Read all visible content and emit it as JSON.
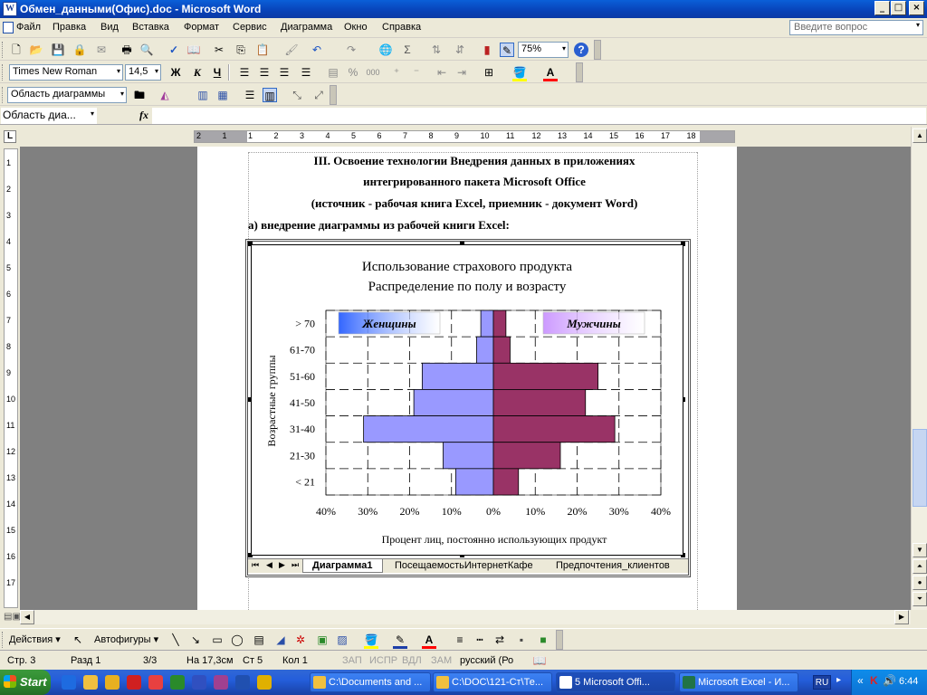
{
  "window": {
    "title": "Обмен_данными(Офис).doc - Microsoft Word",
    "min_glyph": "_",
    "max_glyph": "□",
    "close_glyph": "×"
  },
  "menu": {
    "items": [
      "Файл",
      "Правка",
      "Вид",
      "Вставка",
      "Формат",
      "Сервис",
      "Диаграмма",
      "Окно",
      "Справка"
    ],
    "ask_placeholder": "Введите вопрос",
    "arrow": "▾"
  },
  "toolbar_standard": {
    "zoom": "75%"
  },
  "toolbar_format": {
    "font": "Times New Roman",
    "size": "14,5",
    "bold": "Ж",
    "italic": "К",
    "underline": "Ч"
  },
  "toolbar_chart": {
    "object_select": "Область диаграммы"
  },
  "formula_bar": {
    "name_box": "Область диа...",
    "fx": "fx"
  },
  "ruler": {
    "h_labels": [
      "2",
      "1",
      "1",
      "2",
      "3",
      "4",
      "5",
      "6",
      "7",
      "8",
      "9",
      "10",
      "11",
      "12",
      "13",
      "14",
      "15",
      "16",
      "17",
      "18"
    ],
    "v_labels": [
      "1",
      "2",
      "3",
      "4",
      "5",
      "6",
      "7",
      "8",
      "9",
      "10",
      "11",
      "12",
      "13",
      "14",
      "15",
      "16",
      "17"
    ],
    "tab_selector": "L"
  },
  "document": {
    "heading_lines": [
      "III. Освоение технологии Внедрения данных в приложениях",
      "интегрированного пакета Microsoft Office",
      "(источник - рабочая книга Excel, приемник - документ Word)"
    ],
    "subheading": "а) внедрение диаграммы из рабочей книги Excel:"
  },
  "sheet_tabs": [
    "Диаграмма1",
    "ПосещаемостьИнтернетКафе",
    "Предпочтения_клиентов"
  ],
  "sheet_nav": [
    "⏮",
    "◀",
    "▶",
    "⏭"
  ],
  "chart_data": {
    "type": "bar",
    "orientation": "horizontal",
    "title": "Использование страхового продукта",
    "subtitle": "Распределение по полу и возрасту",
    "categories": [
      "> 70",
      "61-70",
      "51-60",
      "41-50",
      "31-40",
      "21-30",
      "< 21"
    ],
    "series": [
      {
        "name": "Женщины",
        "values": [
          3,
          4,
          17,
          19,
          31,
          12,
          9
        ],
        "color": "#9999FF",
        "direction": "left"
      },
      {
        "name": "Мужчины",
        "values": [
          3,
          4,
          25,
          22,
          29,
          16,
          6
        ],
        "color": "#993366",
        "direction": "right"
      }
    ],
    "xlim": [
      -40,
      40
    ],
    "x_ticks": [
      "40%",
      "30%",
      "20%",
      "10%",
      "0%",
      "10%",
      "20%",
      "30%",
      "40%"
    ],
    "xlabel": "Процент лиц, постоянно использующих продукт",
    "ylabel": "Возрастные группы",
    "grid": "dashed",
    "legend_box_colors": [
      "#3366FF",
      "#CC99FF"
    ]
  },
  "draw_toolbar": {
    "actions": "Действия",
    "autoshapes": "Автофигуры"
  },
  "status_bar": {
    "page": "Стр.  3",
    "section": "Разд  1",
    "pages": "3/3",
    "at": "На  17,3см",
    "line": "Ст  5",
    "col": "Кол  1",
    "rec": "ЗАП",
    "trk": "ИСПР",
    "ext": "ВДЛ",
    "ovr": "ЗАМ",
    "lang": "русский (Ро"
  },
  "taskbar": {
    "start": "Start",
    "tasks": [
      {
        "label": "C:\\Documents and ...",
        "color": "#f0c040"
      },
      {
        "label": "C:\\DOC\\121-Ст\\Те...",
        "color": "#f0c040"
      },
      {
        "label": "5 Microsoft Offi...",
        "color": "#2b579a"
      },
      {
        "label": "Microsoft Excel - И...",
        "color": "#217346"
      }
    ],
    "lang": "RU",
    "clock": "6:44"
  }
}
